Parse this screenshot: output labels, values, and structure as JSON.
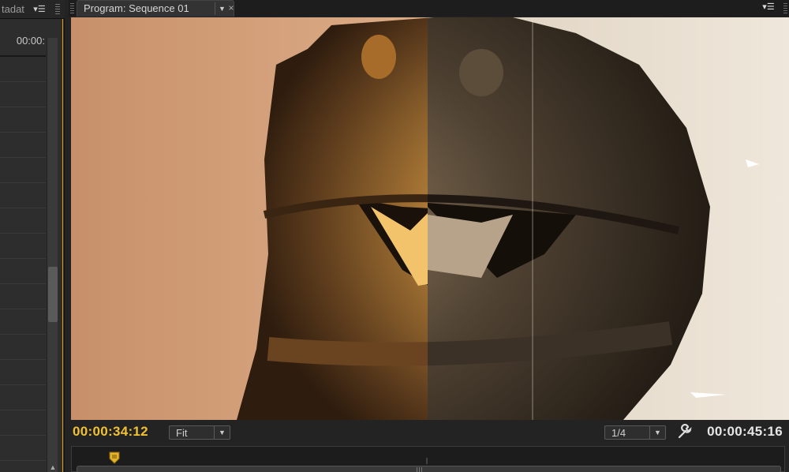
{
  "left_panel": {
    "tab_label": "tadat",
    "menu_icon": "panel-menu-icon",
    "timecode": "00:00:"
  },
  "program_panel": {
    "tab_label": "Program: Sequence 01",
    "dropdown_icon": "chevron-down-icon",
    "close_icon": "close-icon",
    "menu_icon": "panel-menu-icon"
  },
  "controls": {
    "current_timecode": "00:00:34:12",
    "zoom_select": "Fit",
    "resolution_select": "1/4",
    "settings_icon": "wrench-icon",
    "duration_timecode": "00:00:45:16"
  },
  "colors": {
    "accent_timecode": "#f0c233",
    "panel_focus_border": "#e0a100"
  }
}
